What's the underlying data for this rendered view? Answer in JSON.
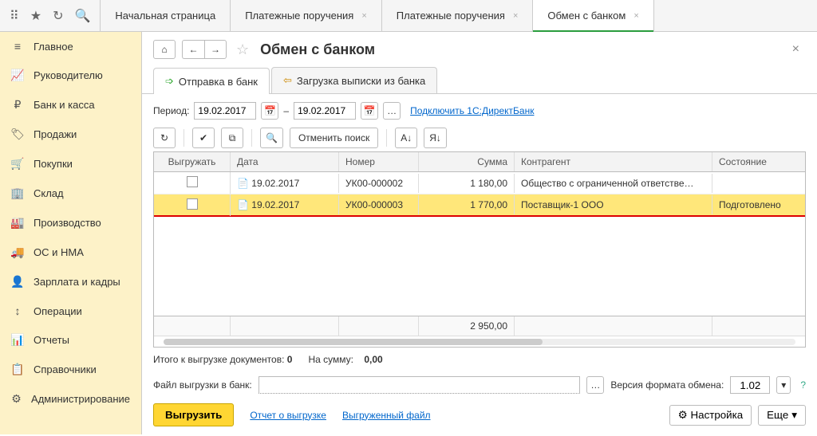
{
  "topbar_icons": [
    "apps",
    "star",
    "loop",
    "search"
  ],
  "tabs": [
    {
      "label": "Начальная страница",
      "closable": false
    },
    {
      "label": "Платежные поручения",
      "closable": true
    },
    {
      "label": "Платежные поручения",
      "closable": true
    },
    {
      "label": "Обмен с банком",
      "closable": true,
      "active": true
    }
  ],
  "sidebar": [
    {
      "icon": "≡",
      "label": "Главное"
    },
    {
      "icon": "📈",
      "label": "Руководителю"
    },
    {
      "icon": "₽",
      "label": "Банк и касса"
    },
    {
      "icon": "🏷",
      "label": "Продажи"
    },
    {
      "icon": "🛒",
      "label": "Покупки"
    },
    {
      "icon": "🏢",
      "label": "Склад"
    },
    {
      "icon": "🏭",
      "label": "Производство"
    },
    {
      "icon": "🚚",
      "label": "ОС и НМА"
    },
    {
      "icon": "👤",
      "label": "Зарплата и кадры"
    },
    {
      "icon": "↕",
      "label": "Операции"
    },
    {
      "icon": "📊",
      "label": "Отчеты"
    },
    {
      "icon": "📋",
      "label": "Справочники"
    },
    {
      "icon": "⚙",
      "label": "Администрирование"
    }
  ],
  "page_title": "Обмен с банком",
  "subtabs": [
    {
      "icon": "➡",
      "label": "Отправка в банк",
      "active": true
    },
    {
      "icon": "⬅",
      "label": "Загрузка выписки из банка"
    }
  ],
  "period": {
    "label": "Период:",
    "from": "19.02.2017",
    "sep": "–",
    "to": "19.02.2017",
    "link": "Подключить 1С:ДиректБанк"
  },
  "toolbar": {
    "cancel_search": "Отменить поиск"
  },
  "grid": {
    "headers": [
      "Выгружать",
      "Дата",
      "Номер",
      "Сумма",
      "Контрагент",
      "Состояние"
    ],
    "rows": [
      {
        "date": "19.02.2017",
        "num": "УК00-000002",
        "sum": "1 180,00",
        "agent": "Общество с ограниченной ответстве…",
        "state": ""
      },
      {
        "date": "19.02.2017",
        "num": "УК00-000003",
        "sum": "1 770,00",
        "agent": "Поставщик-1 ООО",
        "state": "Подготовлено",
        "selected": true
      }
    ],
    "total_sum": "2 950,00"
  },
  "summary": {
    "docs_label": "Итого к выгрузке документов:",
    "docs_count": "0",
    "sum_label": "На сумму:",
    "sum": "0,00"
  },
  "file_row": {
    "label": "Файл выгрузки в банк:",
    "ver_label": "Версия формата обмена:",
    "ver": "1.02"
  },
  "bottom": {
    "export": "Выгрузить",
    "report": "Отчет о выгрузке",
    "file": "Выгруженный файл",
    "settings": "Настройка",
    "more": "Еще"
  }
}
